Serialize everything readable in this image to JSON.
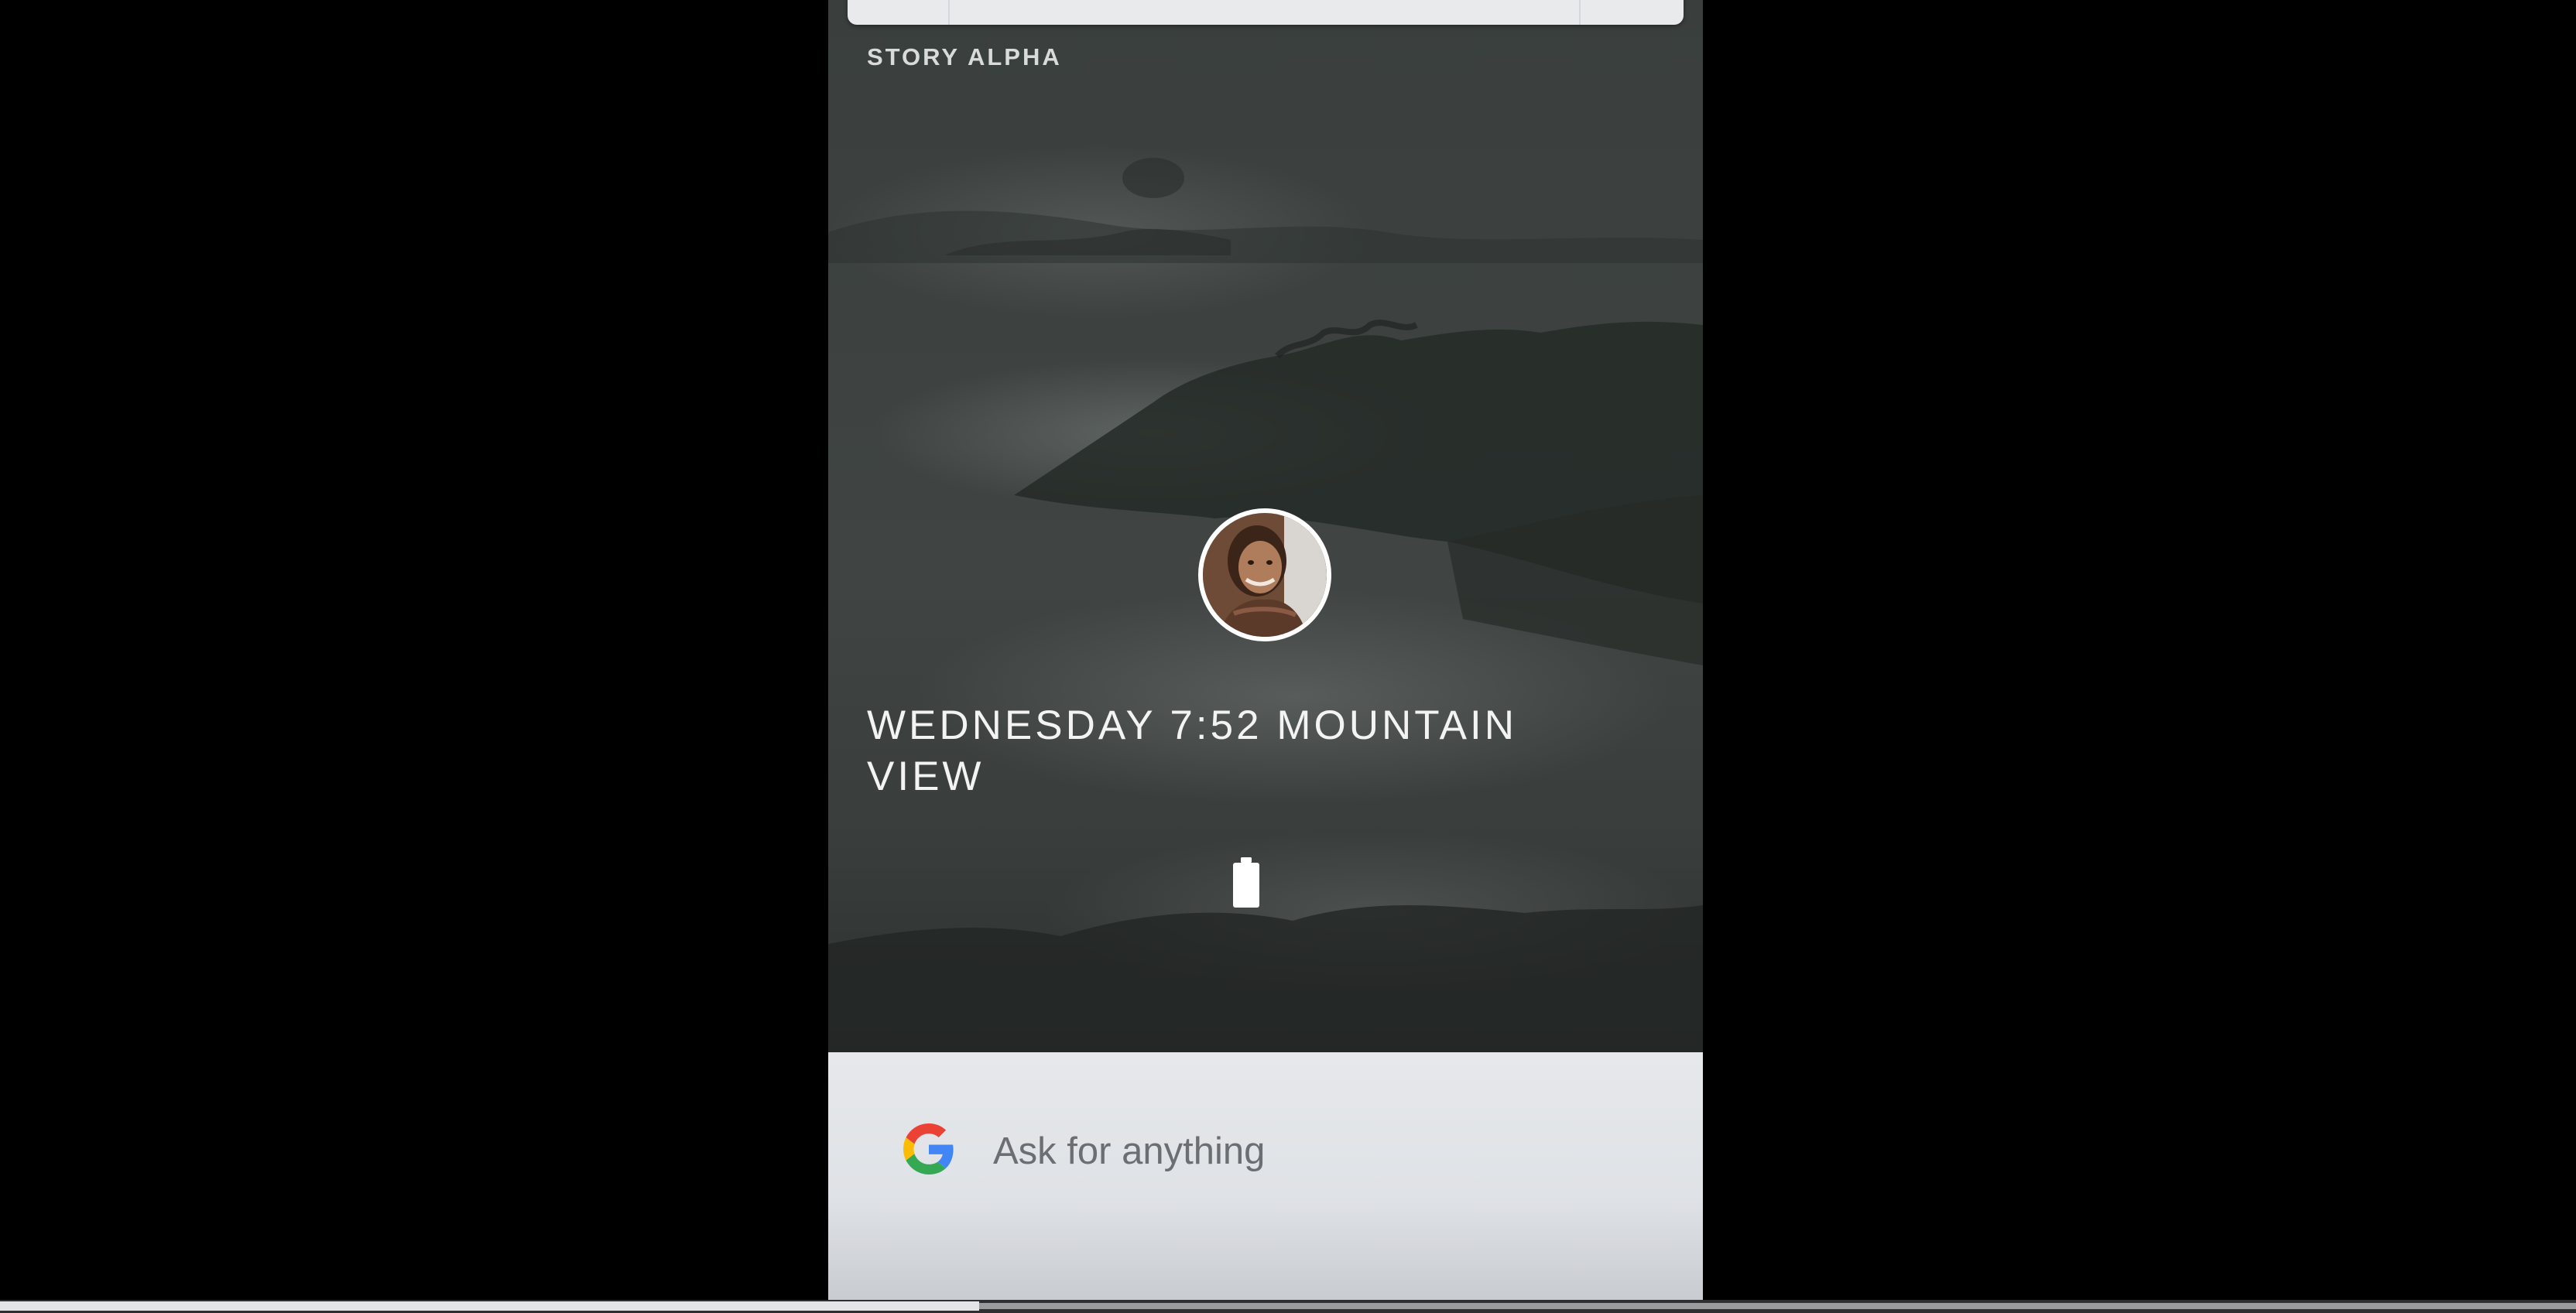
{
  "lockscreen": {
    "story_label": "STORY ALPHA",
    "status_line": "WEDNESDAY 7:52 MOUNTAIN VIEW",
    "battery_icon": "battery-icon",
    "avatar_icon": "user-avatar"
  },
  "assistant": {
    "logo_icon": "google-g-icon",
    "prompt": "Ask for anything"
  },
  "video_player": {
    "progress_fraction": 0.38
  },
  "colors": {
    "google_blue": "#4285F4",
    "google_red": "#EA4335",
    "google_yellow": "#FBBC05",
    "google_green": "#34A853"
  }
}
